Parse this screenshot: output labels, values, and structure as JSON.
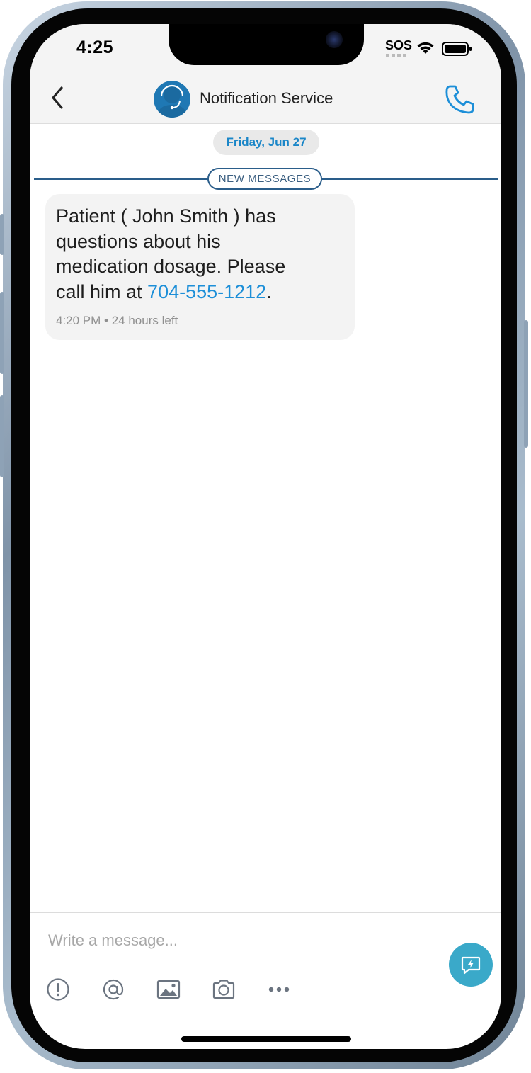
{
  "status_bar": {
    "time": "4:25",
    "carrier_status": "SOS",
    "icons": [
      "wifi-icon",
      "battery-icon"
    ]
  },
  "header": {
    "contact_name": "Notification Service",
    "icons": [
      "back-chevron-icon",
      "support-agent-avatar-icon",
      "phone-call-icon"
    ]
  },
  "conversation": {
    "date_label": "Friday, Jun 27",
    "new_messages_label": "NEW MESSAGES",
    "messages": [
      {
        "line1": "Patient ( John Smith ) has",
        "line2": "questions about his",
        "line3": "medication dosage.  Please",
        "line4_prefix": "call him at ",
        "phone_number": "704-555-1212",
        "line4_suffix": ".",
        "time": "4:20 PM",
        "separator": " • ",
        "expiry": "24 hours left"
      }
    ]
  },
  "composer": {
    "placeholder": "Write a message...",
    "value": "",
    "toolbar_icons": [
      "priority-alert-icon",
      "mention-icon",
      "image-icon",
      "camera-icon",
      "more-icon"
    ],
    "send_icon": "quick-reply-icon"
  },
  "colors": {
    "accent_blue": "#1d8fd8",
    "header_bg": "#f4f4f4",
    "bubble_bg": "#f3f3f3",
    "new_messages_line": "#2a5d8a",
    "send_button": "#3aa9c9",
    "frame": "#8ea2b6"
  }
}
